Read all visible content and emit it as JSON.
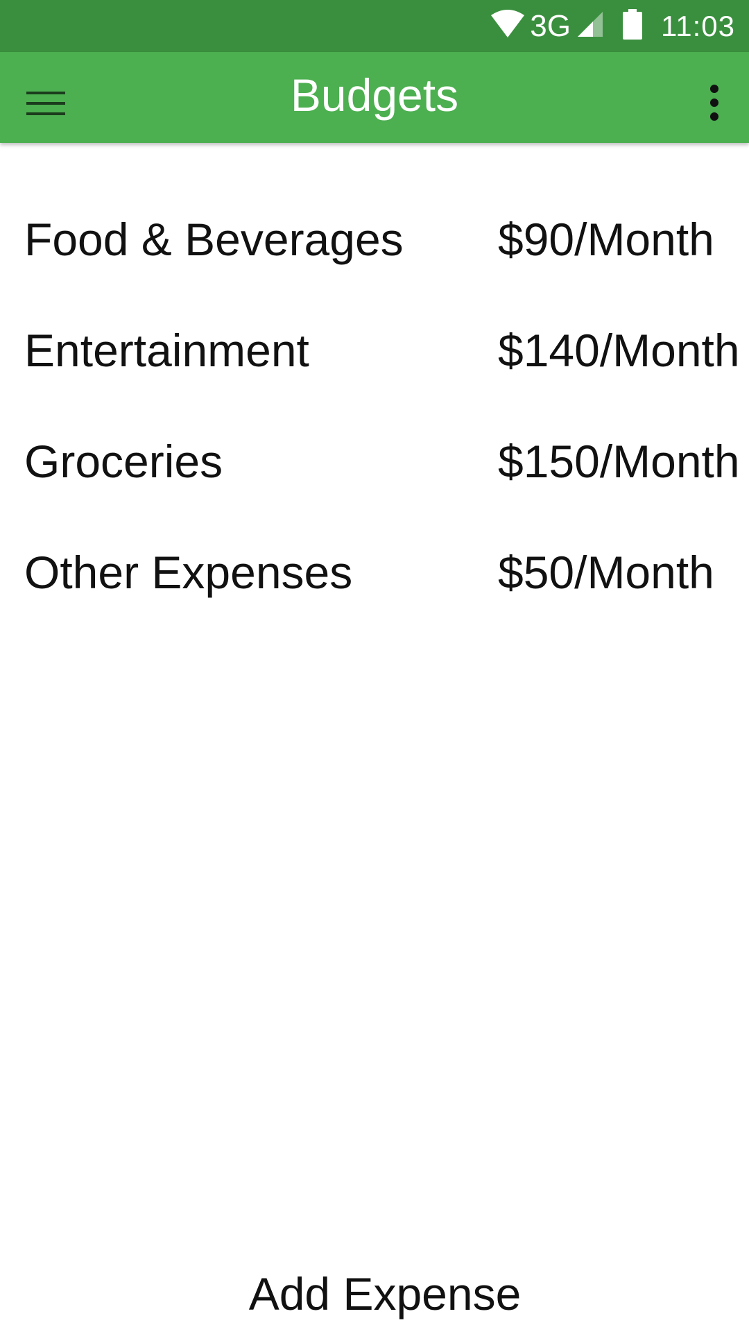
{
  "status_bar": {
    "network": "3G",
    "time": "11:03",
    "icons": [
      "wifi-icon",
      "cell-signal-icon",
      "battery-icon"
    ]
  },
  "app_bar": {
    "title": "Budgets",
    "menu_icon": "hamburger-menu-icon",
    "overflow_icon": "more-vert-icon"
  },
  "budgets": [
    {
      "name": "Food & Beverages",
      "amount": "$90/Month"
    },
    {
      "name": "Entertainment",
      "amount": "$140/Month"
    },
    {
      "name": "Groceries",
      "amount": "$150/Month"
    },
    {
      "name": "Other Expenses",
      "amount": "$50/Month"
    }
  ],
  "footer": {
    "add_expense_label": "Add Expense"
  },
  "colors": {
    "status_bar": "#3a8f3e",
    "app_bar": "#4caf50",
    "text": "#111111",
    "background": "#ffffff"
  }
}
